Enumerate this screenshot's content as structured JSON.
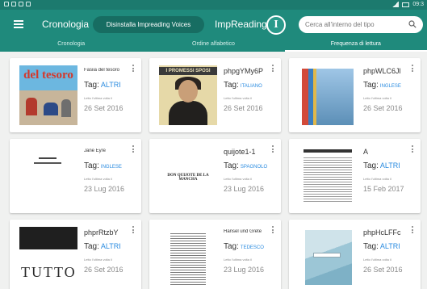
{
  "statusbar": {
    "time": "09:3"
  },
  "appbar": {
    "title": "Cronologia",
    "uninstall_label": "Disinstalla Impreading Voices",
    "brand": "ImpReading",
    "logo_letter": "I",
    "search": {
      "placeholder": "Cerca all'interno del tipo",
      "value": ""
    }
  },
  "tabs": [
    {
      "label": "Cronologia",
      "active": false
    },
    {
      "label": "Ordine alfabetico",
      "active": false
    },
    {
      "label": "Frequenza di lettura",
      "active": true
    }
  ],
  "cards": [
    {
      "title": "Fasiia del tesoro",
      "tag_label": "Tag:",
      "tag": "ALTRI",
      "meta": "Letto l'ultima volta il",
      "date": "26 Set 2016",
      "cover_text": "del tesoro"
    },
    {
      "title": "phpgYMy6P",
      "tag_label": "Tag:",
      "tag": "ITALIANO",
      "meta": "Letto l'ultima volta il",
      "date": "26 Set 2016",
      "cover_text": "I PROMESSI SPOSI"
    },
    {
      "title": "phpWLC6Jl",
      "tag_label": "Tag:",
      "tag": "INGLESE",
      "meta": "Letto l'ultima volta il",
      "date": "26 Set 2016",
      "cover_text": ""
    },
    {
      "title": "Jane Eyre",
      "tag_label": "Tag:",
      "tag": "INGLESE",
      "meta": "Letto l'ultima volta il",
      "date": "23 Lug 2016",
      "cover_text": ""
    },
    {
      "title": "quijote1-1",
      "tag_label": "Tag:",
      "tag": "SPAGNOLO",
      "meta": "Letto l'ultima volta il",
      "date": "23 Lug 2016",
      "cover_text": "DON QUIJOTE DE LA MANCHA"
    },
    {
      "title": "A",
      "tag_label": "Tag:",
      "tag": "ALTRI",
      "meta": "Letto l'ultima volta il",
      "date": "15 Feb 2017",
      "cover_text": ""
    },
    {
      "title": "phprRtzbY",
      "tag_label": "Tag:",
      "tag": "ALTRI",
      "meta": "Letto l'ultima volta il",
      "date": "26 Set 2016",
      "cover_text": "TUTTO"
    },
    {
      "title": "Hansel und Grete",
      "tag_label": "Tag:",
      "tag": "TEDESCO",
      "meta": "Letto l'ultima volta il",
      "date": "23 Lug 2016",
      "cover_text": ""
    },
    {
      "title": "phpHcLFFc",
      "tag_label": "Tag:",
      "tag": "ALTRI",
      "meta": "Letto l'ultima volta il",
      "date": "26 Set 2016",
      "cover_text": ""
    }
  ],
  "colors": {
    "primary": "#1f8a7c",
    "primary_dark": "#176d62",
    "tag": "#2a8be0",
    "background": "#f0f1f0"
  }
}
